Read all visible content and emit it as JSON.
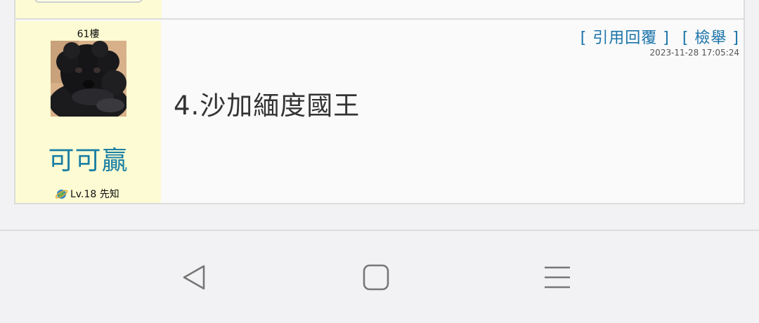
{
  "post": {
    "floor": "61樓",
    "user_name": "可可贏",
    "user_level": "Lv.18 先知",
    "actions": {
      "quote_reply": "[ 引用回覆 ]",
      "report": "[ 檢舉 ]"
    },
    "timestamp": "2023-11-28 17:05:24",
    "content": "4.沙加緬度國王"
  },
  "colors": {
    "sidebar_bg": "#fcfbd3",
    "link_blue": "#1a73a8",
    "username_blue": "#1a7fa4"
  },
  "navbar": {
    "back_icon": "back-triangle-icon",
    "home_icon": "home-square-icon",
    "menu_icon": "menu-lines-icon"
  }
}
